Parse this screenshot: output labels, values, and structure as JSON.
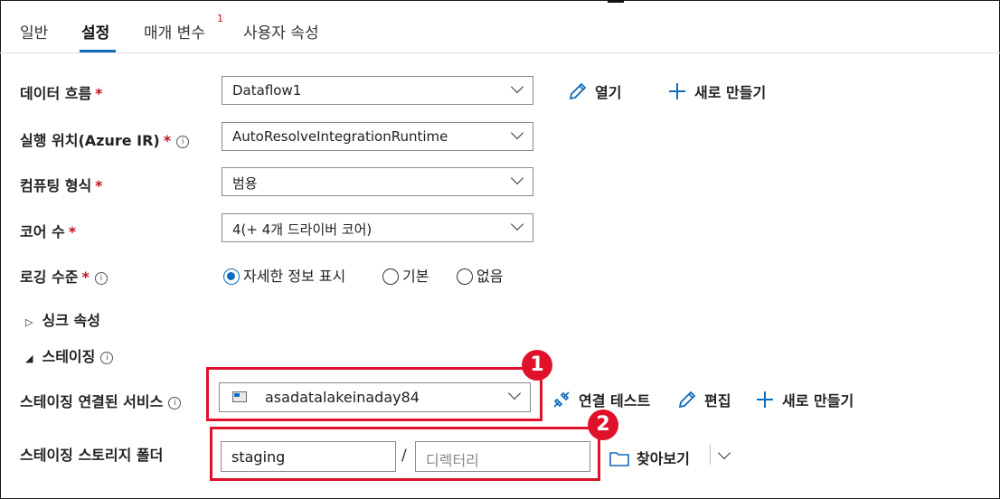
{
  "tabs": [
    {
      "label": "일반"
    },
    {
      "label": "설정",
      "active": true
    },
    {
      "label": "매개 변수",
      "badge": "1"
    },
    {
      "label": "사용자 속성"
    }
  ],
  "form": {
    "dataflow": {
      "label": "데이터 흐름",
      "required": "*",
      "value": "Dataflow1",
      "open_label": "열기",
      "new_label": "새로 만들기"
    },
    "runtime": {
      "label": "실행 위치(Azure IR)",
      "required": "*",
      "value": "AutoResolveIntegrationRuntime"
    },
    "compute_type": {
      "label": "컴퓨팅 형식",
      "required": "*",
      "value": "범용"
    },
    "core_count": {
      "label": "코어 수",
      "required": "*",
      "value": "4(+ 4개 드라이버 코어)"
    },
    "logging": {
      "label": "로깅 수준",
      "required": "*",
      "options": [
        "자세한 정보 표시",
        "기본",
        "없음"
      ],
      "selected": "자세한 정보 표시"
    },
    "sink_section": {
      "label": "싱크 속성",
      "expanded": false
    },
    "staging_section": {
      "label": "스테이징",
      "expanded": true
    },
    "staging_service": {
      "label": "스테이징 연결된 서비스",
      "value": "asadatalakeinaday84",
      "test_label": "연결 테스트",
      "edit_label": "편집",
      "new_label": "새로 만들기"
    },
    "staging_folder": {
      "label": "스테이징 스토리지 폴더",
      "container_value": "staging",
      "directory_placeholder": "디렉터리",
      "browse_label": "찾아보기"
    }
  },
  "callouts": [
    "1",
    "2"
  ],
  "colors": {
    "accent": "#0f6cbd",
    "required": "#c50f1f",
    "highlight": "#e0112b"
  },
  "icons": [
    "pencil-icon",
    "plus-icon",
    "info-icon",
    "chevron-down-icon",
    "connection-test-icon",
    "folder-icon",
    "storage-service-icon"
  ]
}
